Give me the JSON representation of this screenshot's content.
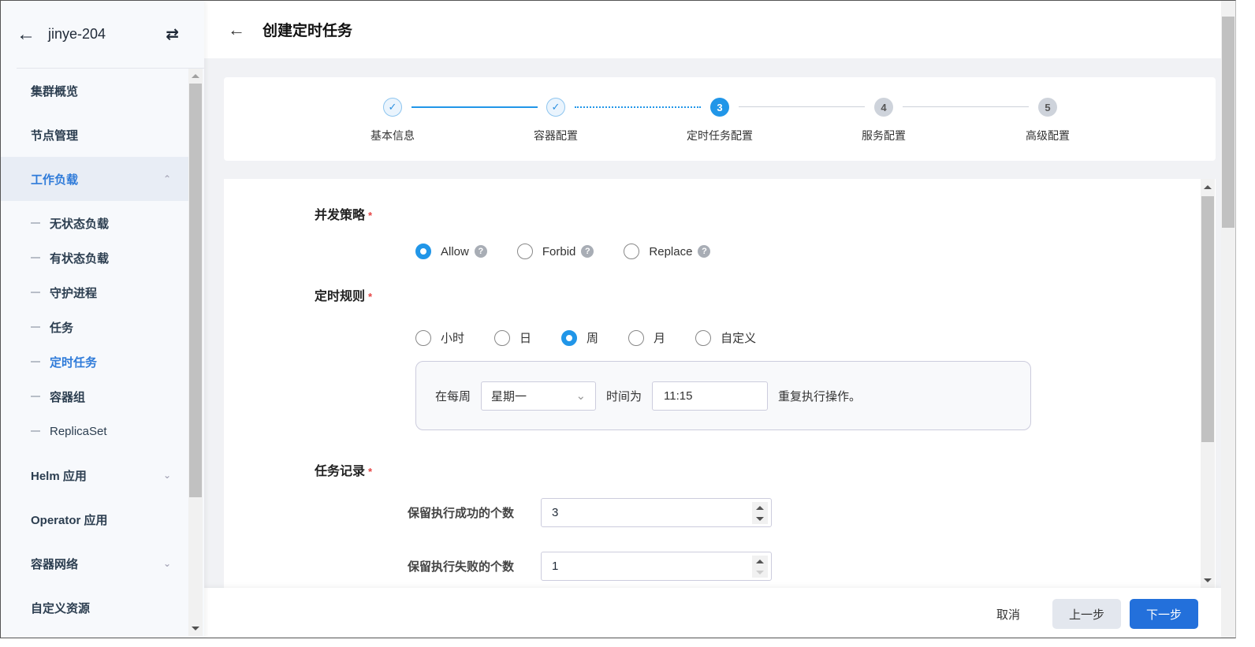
{
  "sidebar": {
    "cluster": "jinye-204",
    "items": [
      {
        "label": "集群概览"
      },
      {
        "label": "节点管理"
      },
      {
        "label": "工作负载",
        "expanded": true
      },
      {
        "label": "Helm 应用"
      },
      {
        "label": "Operator 应用"
      },
      {
        "label": "容器网络"
      },
      {
        "label": "自定义资源"
      }
    ],
    "sub": [
      "无状态负载",
      "有状态负载",
      "守护进程",
      "任务",
      "定时任务",
      "容器组",
      "ReplicaSet"
    ],
    "active_sub": "定时任务"
  },
  "header": {
    "title": "创建定时任务"
  },
  "steps": [
    {
      "num": "1",
      "label": "基本信息",
      "state": "done"
    },
    {
      "num": "2",
      "label": "容器配置",
      "state": "done"
    },
    {
      "num": "3",
      "label": "定时任务配置",
      "state": "current"
    },
    {
      "num": "4",
      "label": "服务配置",
      "state": "todo"
    },
    {
      "num": "5",
      "label": "高级配置",
      "state": "todo"
    }
  ],
  "form": {
    "concurrency": {
      "label": "并发策略",
      "star": "*",
      "options": [
        "Allow",
        "Forbid",
        "Replace"
      ],
      "selected": "Allow",
      "help": "?"
    },
    "schedule": {
      "label": "定时规则",
      "star": "*",
      "options": [
        "小时",
        "日",
        "周",
        "月",
        "自定义"
      ],
      "selected": "周",
      "prefix": "在每周",
      "weekday": "星期一",
      "mid": "时间为",
      "time": "11:15",
      "suffix": "重复执行操作。"
    },
    "history": {
      "label": "任务记录",
      "star": "*",
      "success_label": "保留执行成功的个数",
      "success_value": "3",
      "failed_label": "保留执行失败的个数",
      "failed_value": "1"
    }
  },
  "footer": {
    "cancel": "取消",
    "prev": "上一步",
    "next": "下一步"
  },
  "colors": {
    "accent": "#2196e8",
    "primary_button": "#2370db",
    "active_nav": "#2f7bd9"
  }
}
